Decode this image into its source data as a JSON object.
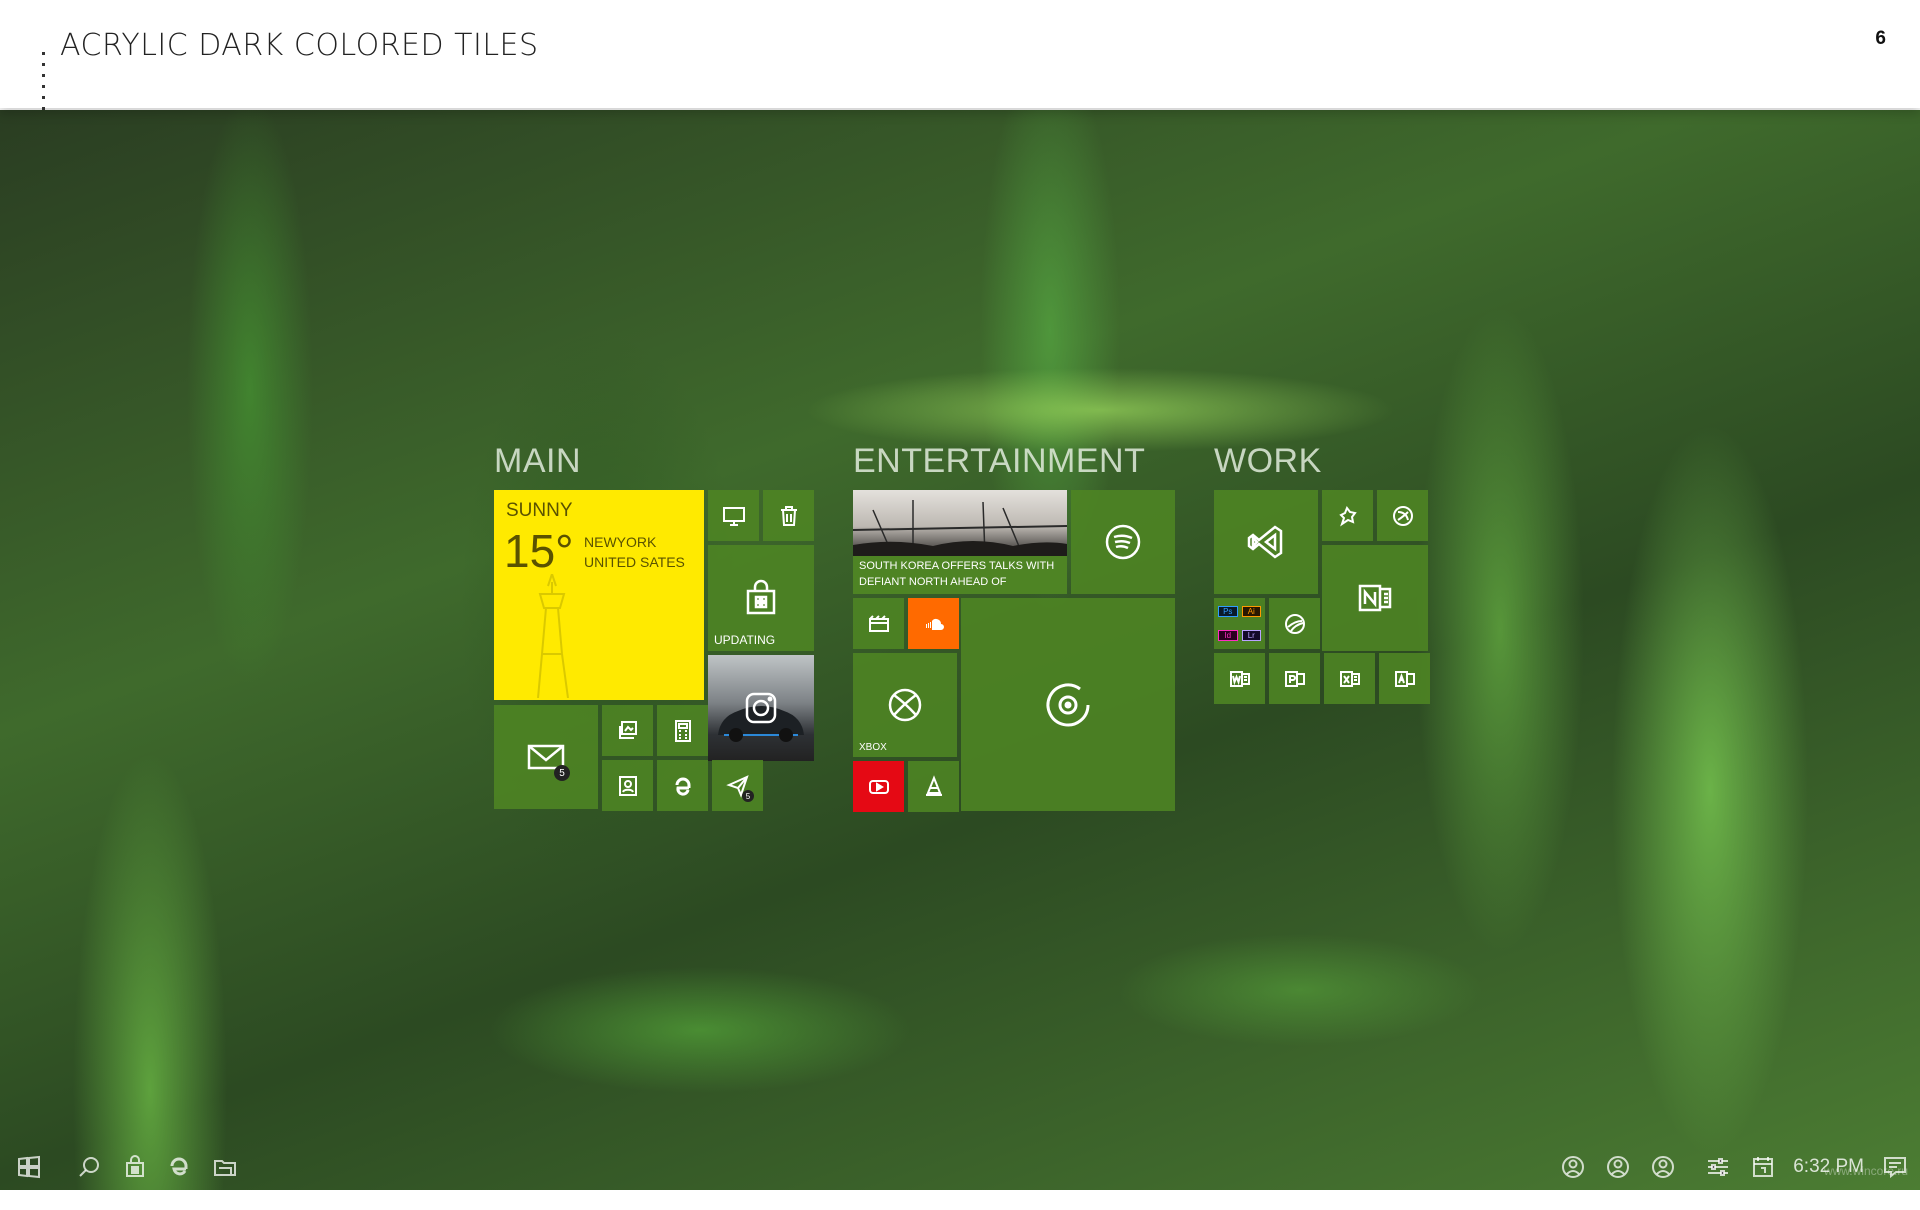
{
  "slide": {
    "title": "ACRYLIC DARK COLORED TILES",
    "page_number": "6"
  },
  "groups": {
    "main": {
      "title": "MAIN"
    },
    "entertainment": {
      "title": "ENTERTAINMENT"
    },
    "work": {
      "title": "WORK"
    }
  },
  "tiles": {
    "weather": {
      "condition": "SUNNY",
      "temperature": "15°",
      "city": "NEWYORK",
      "country": "UNITED SATES",
      "color": "#ffea00"
    },
    "store": {
      "label": "UPDATING"
    },
    "mail": {
      "badge": "5"
    },
    "send": {
      "badge": "5"
    },
    "news": {
      "headline": "SOUTH KOREA OFFERS TALKS WITH DEFIANT NORTH AHEAD OF"
    },
    "xbox": {
      "label": "XBOX"
    },
    "soundcloud": {
      "color": "#ff6a00"
    },
    "youtube": {
      "color": "#e50914"
    }
  },
  "taskbar": {
    "time": "6:32 PM"
  },
  "watermark": "www.wincore.ru",
  "colors": {
    "tile": "#4e8424",
    "accent": "#ffea00"
  }
}
